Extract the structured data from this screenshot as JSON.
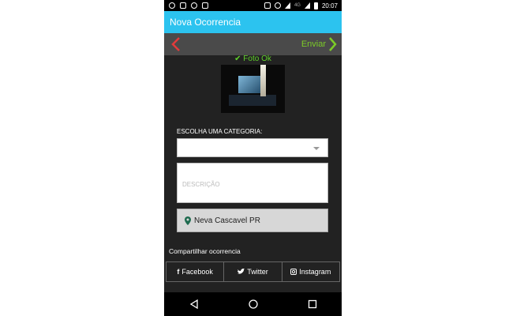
{
  "status_bar": {
    "time": "20:07",
    "network": "4G",
    "icons": [
      "whatsapp-icon",
      "missed-call-icon",
      "image-icon",
      "mail-icon",
      "vibrate-icon",
      "alarm-icon",
      "wifi-icon",
      "signal-icon",
      "battery-icon"
    ]
  },
  "appbar": {
    "title": "Nova Ocorrencia"
  },
  "nav": {
    "send_label": "Enviar",
    "back_color": "#e23b3b",
    "send_color": "#7ccc27"
  },
  "photo": {
    "status_label": "Foto Ok"
  },
  "form": {
    "category_label": "ESCOLHA UMA CATEGORIA:",
    "category_value": "",
    "description_placeholder": "DESCRIÇÃO",
    "location": "Neva Cascavel PR"
  },
  "share": {
    "label": "Compartilhar ocorrencia",
    "buttons": [
      {
        "label": "Facebook",
        "icon": "facebook-icon"
      },
      {
        "label": "Twitter",
        "icon": "twitter-icon"
      },
      {
        "label": "Instagram",
        "icon": "instagram-icon"
      }
    ]
  },
  "colors": {
    "appbar": "#2cc3ef",
    "background": "#222222",
    "accent_green": "#5fd02a"
  }
}
